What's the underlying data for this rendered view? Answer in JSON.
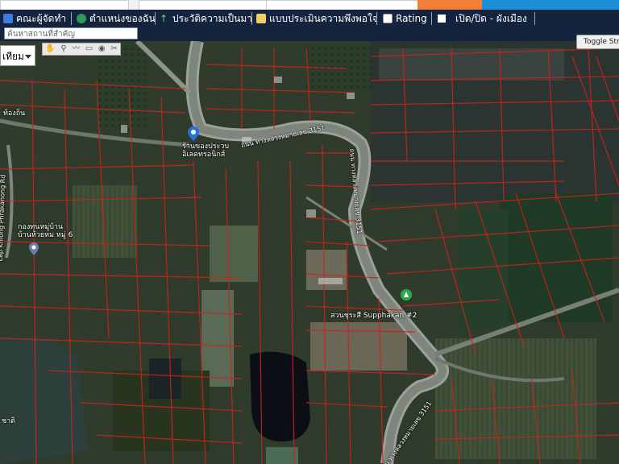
{
  "header": {
    "menu_items": [
      {
        "label": "คณะผู้จัดทำ",
        "icon": "people-icon"
      },
      {
        "label": "ตำแหน่งของฉัน",
        "icon": "globe-icon"
      },
      {
        "label": "ประวัติความเป็นมา",
        "icon": "plant-icon"
      },
      {
        "label": "แบบประเมินความพึงพอใจ",
        "icon": "document-icon"
      },
      {
        "label": "Rating",
        "icon": "chart-icon"
      },
      {
        "label": "เปิด/ปิด - ผังเมือง",
        "icon": "checkbox-icon"
      }
    ],
    "search_placeholder": "ค้นหาสถานที่สำคัญ"
  },
  "map": {
    "layer_select_value": "เทียม",
    "toggle_button_label": "Toggle Street",
    "tools": [
      "hand-icon",
      "marker-icon",
      "line-icon",
      "polygon-icon",
      "circle-icon",
      "clear-icon"
    ],
    "labels": {
      "road_label_top": "ถนน ทางหลวงหมายเลข 3151",
      "road_label_vertical": "ถนน ทางหลวงหมายเลข 3151",
      "road_label_bottom": "ถนน ทางหลวงหมายเลข 3151",
      "left_road": "Lap Khlong Phrakanong Rd",
      "poi_top": "ร้านของประวบ อิเลคทรอนิกส์",
      "poi_left": "กองทุนหมู่บ้าน บ้านห้วยหม หมู่ 6",
      "poi_bottom": "สวนชุระสี Supphakan #2",
      "corner_top_left": "ท้องถิ่น",
      "corner_bottom_left": "ชาติ"
    },
    "colors": {
      "parcel_lines": "#d02020",
      "road": "#8e958f",
      "menu_bg": "#14243f"
    }
  }
}
